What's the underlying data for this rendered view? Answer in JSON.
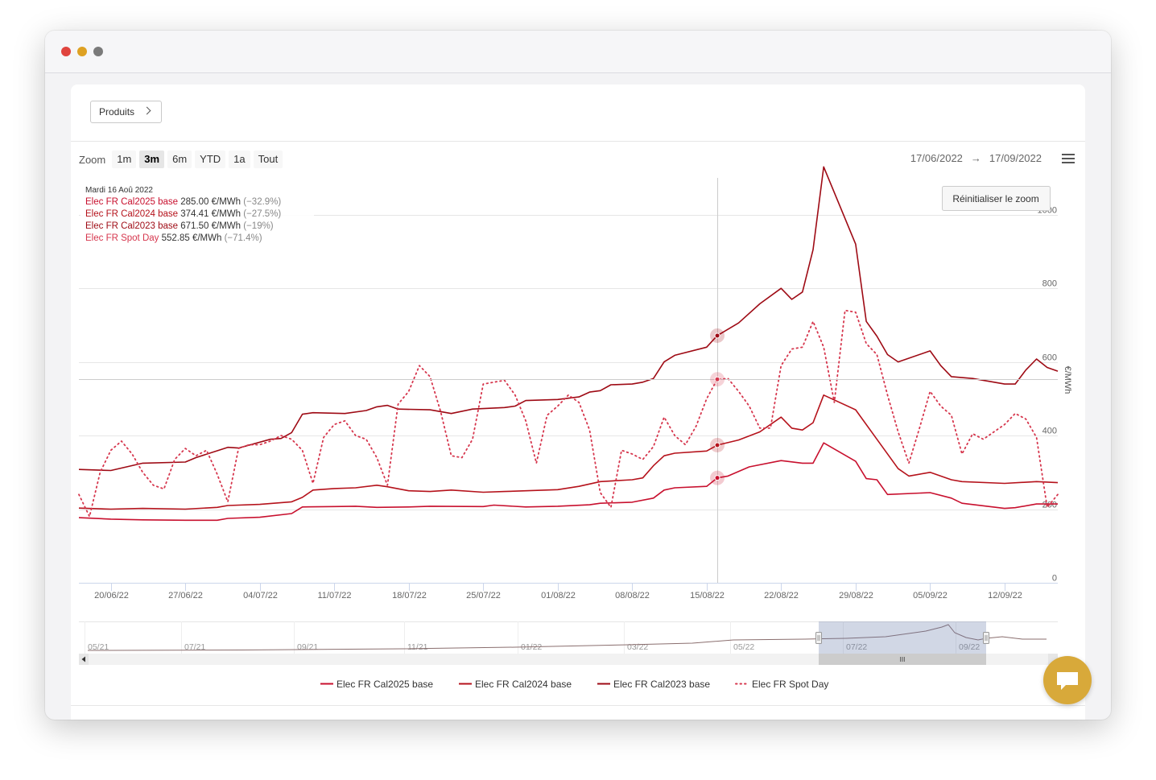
{
  "toolbar": {
    "products_label": "Produits",
    "zoom_label": "Zoom",
    "zoom_buttons": [
      "1m",
      "3m",
      "6m",
      "YTD",
      "1a",
      "Tout"
    ],
    "active_zoom": "3m",
    "range_from": "17/06/2022",
    "range_arrow": "→",
    "range_to": "17/09/2022"
  },
  "reset_zoom_label": "Réinitialiser le zoom",
  "tooltip": {
    "date": "Mardi 16 Aoû 2022",
    "rows": [
      {
        "name": "Elec FR Cal2025 base",
        "value": "285.00 €/MWh",
        "change": "(−32.9%)",
        "color": "#c8102e"
      },
      {
        "name": "Elec FR Cal2024 base",
        "value": "374.41 €/MWh",
        "change": "(−27.5%)",
        "color": "#b5121b"
      },
      {
        "name": "Elec FR Cal2023 base",
        "value": "671.50 €/MWh",
        "change": "(−19%)",
        "color": "#9e0a14"
      },
      {
        "name": "Elec FR Spot Day",
        "value": "552.85 €/MWh",
        "change": "(−71.4%)",
        "color": "#d6364d"
      }
    ]
  },
  "navigator": {
    "labels": [
      "05/21",
      "07/21",
      "09/21",
      "11/21",
      "01/22",
      "03/22",
      "05/22",
      "07/22",
      "09/22"
    ],
    "scrollbar_grip": "III"
  },
  "chart_data": {
    "type": "line",
    "ylabel": "€/MWh",
    "ylim": [
      0,
      1100
    ],
    "yticks": [
      0,
      200,
      400,
      600,
      800,
      1000
    ],
    "xlim": [
      "2022-06-17",
      "2022-09-17"
    ],
    "xticks": [
      "20/06/22",
      "27/06/22",
      "04/07/22",
      "11/07/22",
      "18/07/22",
      "25/07/22",
      "01/08/22",
      "08/08/22",
      "15/08/22",
      "22/08/22",
      "29/08/22",
      "05/09/22",
      "12/09/22"
    ],
    "crosshair_date": "2022-08-16",
    "crosshair_value": 552.85,
    "legend_position": "bottom",
    "series": [
      {
        "name": "Elec FR Cal2025 base",
        "color": "#c8102e",
        "dash": "solid",
        "points": [
          [
            "2022-06-17",
            177
          ],
          [
            "2022-06-20",
            173
          ],
          [
            "2022-06-23",
            171
          ],
          [
            "2022-06-27",
            170
          ],
          [
            "2022-06-30",
            170
          ],
          [
            "2022-07-01",
            175
          ],
          [
            "2022-07-04",
            178
          ],
          [
            "2022-07-07",
            188
          ],
          [
            "2022-07-08",
            206
          ],
          [
            "2022-07-11",
            207
          ],
          [
            "2022-07-13",
            208
          ],
          [
            "2022-07-15",
            205
          ],
          [
            "2022-07-18",
            206
          ],
          [
            "2022-07-20",
            208
          ],
          [
            "2022-07-25",
            207
          ],
          [
            "2022-07-26",
            211
          ],
          [
            "2022-07-29",
            206
          ],
          [
            "2022-08-01",
            208
          ],
          [
            "2022-08-04",
            212
          ],
          [
            "2022-08-05",
            216
          ],
          [
            "2022-08-08",
            219
          ],
          [
            "2022-08-10",
            230
          ],
          [
            "2022-08-11",
            252
          ],
          [
            "2022-08-12",
            258
          ],
          [
            "2022-08-15",
            262
          ],
          [
            "2022-08-16",
            285
          ],
          [
            "2022-08-17",
            290
          ],
          [
            "2022-08-19",
            315
          ],
          [
            "2022-08-22",
            332
          ],
          [
            "2022-08-24",
            325
          ],
          [
            "2022-08-25",
            325
          ],
          [
            "2022-08-26",
            380
          ],
          [
            "2022-08-29",
            330
          ],
          [
            "2022-08-30",
            283
          ],
          [
            "2022-08-31",
            280
          ],
          [
            "2022-09-01",
            240
          ],
          [
            "2022-09-05",
            245
          ],
          [
            "2022-09-07",
            230
          ],
          [
            "2022-09-08",
            216
          ],
          [
            "2022-09-12",
            202
          ],
          [
            "2022-09-13",
            204
          ],
          [
            "2022-09-15",
            214
          ],
          [
            "2022-09-17",
            214
          ]
        ]
      },
      {
        "name": "Elec FR Cal2024 base",
        "color": "#b5121b",
        "dash": "solid",
        "points": [
          [
            "2022-06-17",
            203
          ],
          [
            "2022-06-20",
            200
          ],
          [
            "2022-06-23",
            202
          ],
          [
            "2022-06-27",
            200
          ],
          [
            "2022-06-30",
            205
          ],
          [
            "2022-07-01",
            210
          ],
          [
            "2022-07-04",
            213
          ],
          [
            "2022-07-07",
            220
          ],
          [
            "2022-07-08",
            232
          ],
          [
            "2022-07-09",
            252
          ],
          [
            "2022-07-11",
            256
          ],
          [
            "2022-07-13",
            258
          ],
          [
            "2022-07-15",
            265
          ],
          [
            "2022-07-16",
            261
          ],
          [
            "2022-07-18",
            250
          ],
          [
            "2022-07-20",
            248
          ],
          [
            "2022-07-22",
            252
          ],
          [
            "2022-07-25",
            246
          ],
          [
            "2022-07-27",
            248
          ],
          [
            "2022-07-29",
            250
          ],
          [
            "2022-08-01",
            253
          ],
          [
            "2022-08-03",
            262
          ],
          [
            "2022-08-05",
            275
          ],
          [
            "2022-08-08",
            280
          ],
          [
            "2022-08-09",
            285
          ],
          [
            "2022-08-10",
            318
          ],
          [
            "2022-08-11",
            345
          ],
          [
            "2022-08-12",
            352
          ],
          [
            "2022-08-15",
            358
          ],
          [
            "2022-08-16",
            374
          ],
          [
            "2022-08-18",
            388
          ],
          [
            "2022-08-20",
            410
          ],
          [
            "2022-08-22",
            450
          ],
          [
            "2022-08-23",
            420
          ],
          [
            "2022-08-24",
            415
          ],
          [
            "2022-08-25",
            435
          ],
          [
            "2022-08-26",
            510
          ],
          [
            "2022-08-29",
            470
          ],
          [
            "2022-08-31",
            390
          ],
          [
            "2022-09-02",
            310
          ],
          [
            "2022-09-03",
            290
          ],
          [
            "2022-09-05",
            300
          ],
          [
            "2022-09-07",
            280
          ],
          [
            "2022-09-08",
            275
          ],
          [
            "2022-09-12",
            270
          ],
          [
            "2022-09-15",
            275
          ],
          [
            "2022-09-17",
            272
          ]
        ]
      },
      {
        "name": "Elec FR Cal2023 base",
        "color": "#9e0a14",
        "dash": "solid",
        "points": [
          [
            "2022-06-17",
            308
          ],
          [
            "2022-06-20",
            305
          ],
          [
            "2022-06-23",
            325
          ],
          [
            "2022-06-27",
            328
          ],
          [
            "2022-06-28",
            340
          ],
          [
            "2022-07-01",
            368
          ],
          [
            "2022-07-02",
            366
          ],
          [
            "2022-07-05",
            390
          ],
          [
            "2022-07-06",
            392
          ],
          [
            "2022-07-07",
            408
          ],
          [
            "2022-07-08",
            458
          ],
          [
            "2022-07-09",
            462
          ],
          [
            "2022-07-12",
            460
          ],
          [
            "2022-07-14",
            468
          ],
          [
            "2022-07-15",
            478
          ],
          [
            "2022-07-16",
            482
          ],
          [
            "2022-07-17",
            472
          ],
          [
            "2022-07-20",
            470
          ],
          [
            "2022-07-22",
            460
          ],
          [
            "2022-07-24",
            472
          ],
          [
            "2022-07-27",
            476
          ],
          [
            "2022-07-28",
            480
          ],
          [
            "2022-07-29",
            495
          ],
          [
            "2022-08-01",
            498
          ],
          [
            "2022-08-03",
            505
          ],
          [
            "2022-08-04",
            518
          ],
          [
            "2022-08-05",
            522
          ],
          [
            "2022-08-06",
            538
          ],
          [
            "2022-08-08",
            540
          ],
          [
            "2022-08-09",
            545
          ],
          [
            "2022-08-10",
            555
          ],
          [
            "2022-08-11",
            600
          ],
          [
            "2022-08-12",
            618
          ],
          [
            "2022-08-15",
            640
          ],
          [
            "2022-08-16",
            671.5
          ],
          [
            "2022-08-18",
            706
          ],
          [
            "2022-08-20",
            758
          ],
          [
            "2022-08-22",
            800
          ],
          [
            "2022-08-23",
            770
          ],
          [
            "2022-08-24",
            790
          ],
          [
            "2022-08-25",
            905
          ],
          [
            "2022-08-26",
            1130
          ],
          [
            "2022-08-29",
            920
          ],
          [
            "2022-08-30",
            710
          ],
          [
            "2022-08-31",
            670
          ],
          [
            "2022-09-01",
            620
          ],
          [
            "2022-09-02",
            600
          ],
          [
            "2022-09-05",
            630
          ],
          [
            "2022-09-06",
            590
          ],
          [
            "2022-09-07",
            560
          ],
          [
            "2022-09-09",
            555
          ],
          [
            "2022-09-12",
            540
          ],
          [
            "2022-09-13",
            540
          ],
          [
            "2022-09-14",
            578
          ],
          [
            "2022-09-15",
            608
          ],
          [
            "2022-09-16",
            585
          ],
          [
            "2022-09-17",
            575
          ]
        ]
      },
      {
        "name": "Elec FR Spot Day",
        "color": "#d6364d",
        "dash": "dotted",
        "points": [
          [
            "2022-06-17",
            240
          ],
          [
            "2022-06-18",
            180
          ],
          [
            "2022-06-19",
            300
          ],
          [
            "2022-06-20",
            360
          ],
          [
            "2022-06-21",
            385
          ],
          [
            "2022-06-22",
            350
          ],
          [
            "2022-06-23",
            300
          ],
          [
            "2022-06-24",
            265
          ],
          [
            "2022-06-25",
            255
          ],
          [
            "2022-06-26",
            335
          ],
          [
            "2022-06-27",
            365
          ],
          [
            "2022-06-28",
            345
          ],
          [
            "2022-06-29",
            360
          ],
          [
            "2022-06-30",
            295
          ],
          [
            "2022-07-01",
            220
          ],
          [
            "2022-07-02",
            365
          ],
          [
            "2022-07-03",
            375
          ],
          [
            "2022-07-04",
            375
          ],
          [
            "2022-07-05",
            385
          ],
          [
            "2022-07-06",
            400
          ],
          [
            "2022-07-07",
            390
          ],
          [
            "2022-07-08",
            360
          ],
          [
            "2022-07-09",
            270
          ],
          [
            "2022-07-10",
            395
          ],
          [
            "2022-07-11",
            430
          ],
          [
            "2022-07-12",
            440
          ],
          [
            "2022-07-13",
            400
          ],
          [
            "2022-07-14",
            390
          ],
          [
            "2022-07-15",
            340
          ],
          [
            "2022-07-16",
            265
          ],
          [
            "2022-07-17",
            485
          ],
          [
            "2022-07-18",
            520
          ],
          [
            "2022-07-19",
            590
          ],
          [
            "2022-07-20",
            560
          ],
          [
            "2022-07-21",
            465
          ],
          [
            "2022-07-22",
            345
          ],
          [
            "2022-07-23",
            340
          ],
          [
            "2022-07-24",
            390
          ],
          [
            "2022-07-25",
            540
          ],
          [
            "2022-07-26",
            545
          ],
          [
            "2022-07-27",
            550
          ],
          [
            "2022-07-28",
            510
          ],
          [
            "2022-07-29",
            440
          ],
          [
            "2022-07-30",
            325
          ],
          [
            "2022-07-31",
            455
          ],
          [
            "2022-08-01",
            480
          ],
          [
            "2022-08-02",
            510
          ],
          [
            "2022-08-03",
            490
          ],
          [
            "2022-08-04",
            415
          ],
          [
            "2022-08-05",
            245
          ],
          [
            "2022-08-06",
            205
          ],
          [
            "2022-08-07",
            360
          ],
          [
            "2022-08-08",
            350
          ],
          [
            "2022-08-09",
            335
          ],
          [
            "2022-08-10",
            370
          ],
          [
            "2022-08-11",
            450
          ],
          [
            "2022-08-12",
            400
          ],
          [
            "2022-08-13",
            375
          ],
          [
            "2022-08-14",
            425
          ],
          [
            "2022-08-15",
            500
          ],
          [
            "2022-08-16",
            552.85
          ],
          [
            "2022-08-17",
            555
          ],
          [
            "2022-08-18",
            520
          ],
          [
            "2022-08-19",
            480
          ],
          [
            "2022-08-20",
            420
          ],
          [
            "2022-08-21",
            420
          ],
          [
            "2022-08-22",
            590
          ],
          [
            "2022-08-23",
            635
          ],
          [
            "2022-08-24",
            640
          ],
          [
            "2022-08-25",
            710
          ],
          [
            "2022-08-26",
            640
          ],
          [
            "2022-08-27",
            490
          ],
          [
            "2022-08-28",
            740
          ],
          [
            "2022-08-29",
            735
          ],
          [
            "2022-08-30",
            650
          ],
          [
            "2022-08-31",
            620
          ],
          [
            "2022-09-01",
            510
          ],
          [
            "2022-09-02",
            410
          ],
          [
            "2022-09-03",
            325
          ],
          [
            "2022-09-04",
            420
          ],
          [
            "2022-09-05",
            520
          ],
          [
            "2022-09-06",
            480
          ],
          [
            "2022-09-07",
            455
          ],
          [
            "2022-09-08",
            350
          ],
          [
            "2022-09-09",
            405
          ],
          [
            "2022-09-10",
            390
          ],
          [
            "2022-09-11",
            410
          ],
          [
            "2022-09-12",
            430
          ],
          [
            "2022-09-13",
            460
          ],
          [
            "2022-09-14",
            445
          ],
          [
            "2022-09-15",
            395
          ],
          [
            "2022-09-16",
            205
          ],
          [
            "2022-09-17",
            240
          ]
        ]
      }
    ]
  }
}
